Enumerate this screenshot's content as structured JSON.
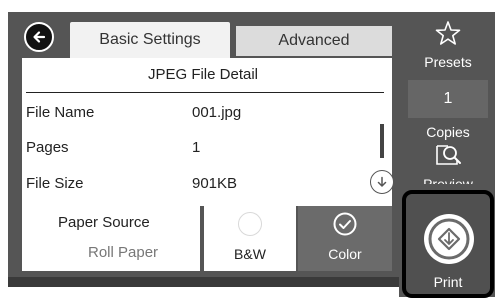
{
  "tabs": {
    "basic_label": "Basic Settings",
    "advanced_label": "Advanced"
  },
  "detail": {
    "title": "JPEG File Detail",
    "rows": [
      {
        "label": "File Name",
        "value": "001.jpg"
      },
      {
        "label": "Pages",
        "value": "1"
      },
      {
        "label": "File Size",
        "value": "901KB"
      }
    ]
  },
  "paper_source": {
    "label": "Paper Source",
    "value": "Roll Paper"
  },
  "color_mode": {
    "bw_label": "B&W",
    "color_label": "Color",
    "selected": "Color"
  },
  "side": {
    "presets_label": "Presets",
    "copies_value": "1",
    "copies_label": "Copies",
    "preview_label": "Preview",
    "print_label": "Print"
  },
  "icons": [
    "back-arrow-icon",
    "scroll-down-icon",
    "radio-empty-icon",
    "check-circle-icon",
    "star-icon",
    "magnifier-icon",
    "print-diamond-icon"
  ],
  "colors": {
    "frame": "#555555",
    "panel": "#ffffff",
    "selected_mode": "#6b6b6b",
    "highlight_border": "#000000"
  }
}
